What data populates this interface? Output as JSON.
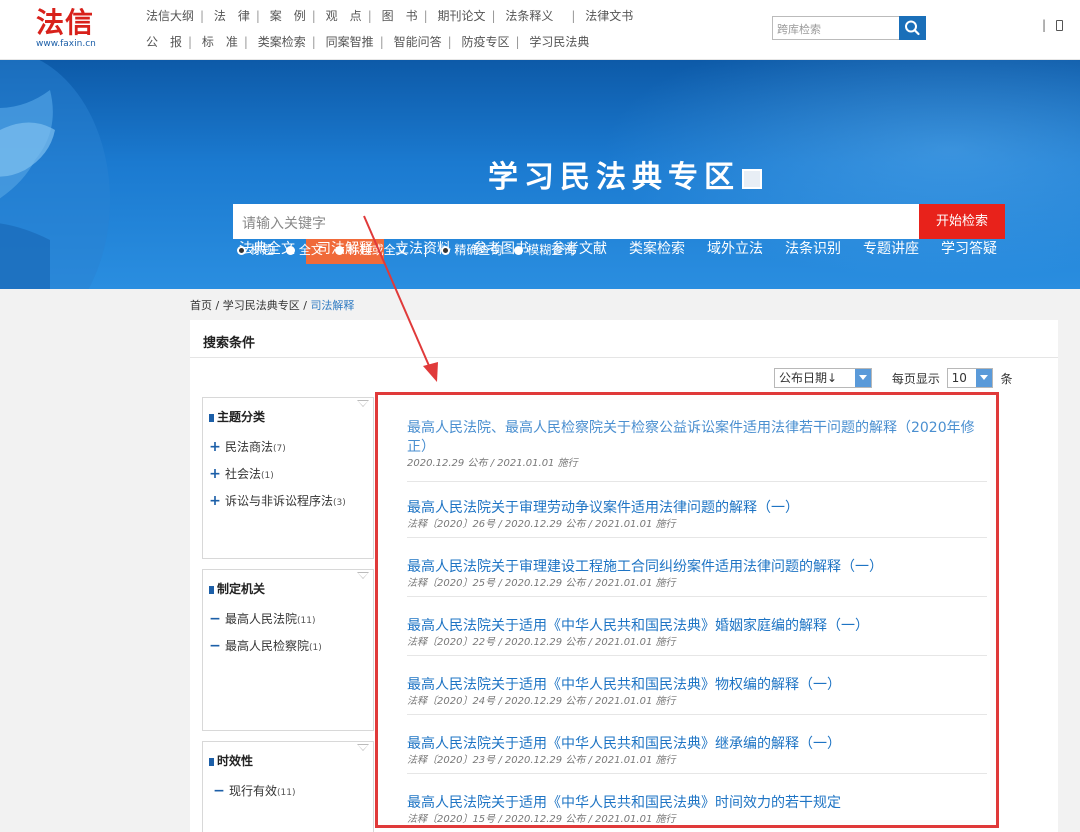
{
  "logo": {
    "text": "法信",
    "url": "www.faxin.cn"
  },
  "top_nav": {
    "row1": [
      "法信大纲",
      "法　律",
      "案　例",
      "观　点",
      "图　书",
      "期刊论文",
      "法条释义",
      "法律文书"
    ],
    "row2": [
      "公　报",
      "标　准",
      "类案检索",
      "同案智推",
      "智能问答",
      "防疫专区",
      "学习民法典"
    ],
    "search_placeholder": "跨库检索",
    "right_text": "|"
  },
  "banner": {
    "title": "学习民法典专区",
    "tabs": [
      "法典全文",
      "司法解释",
      "立法资料",
      "参考图书",
      "参考文献",
      "类案检索",
      "域外立法",
      "法条识别",
      "专题讲座",
      "学习答疑"
    ],
    "active_tab": "司法解释",
    "search_placeholder": "请输入关键字",
    "search_button": "开始检索",
    "scope_options": [
      "标题",
      "全文",
      "标题或全文"
    ],
    "match_options": [
      "精确查询",
      "模糊查询"
    ]
  },
  "breadcrumb": {
    "home": "首页",
    "sep": "/",
    "section": "学习民法典专区",
    "current": "司法解释"
  },
  "panel": {
    "header": "搜索条件",
    "sort_label": "公布日期↓",
    "per_page_label": "每页显示",
    "per_page_value": "10",
    "per_page_unit": "条"
  },
  "filters": {
    "topic": {
      "title": "主题分类",
      "items": [
        {
          "label": "民法商法",
          "count": "(7)"
        },
        {
          "label": "社会法",
          "count": "(1)"
        },
        {
          "label": "诉讼与非诉讼程序法",
          "count": "(3)"
        }
      ]
    },
    "authority": {
      "title": "制定机关",
      "items": [
        {
          "label": "最高人民法院",
          "count": "(11)"
        },
        {
          "label": "最高人民检察院",
          "count": "(1)"
        }
      ]
    },
    "validity": {
      "title": "时效性",
      "items": [
        {
          "label": "现行有效",
          "count": "(11)"
        }
      ]
    }
  },
  "results": [
    {
      "title": "最高人民法院、最高人民检察院关于检察公益诉讼案件适用法律若干问题的解释（2020年修正）",
      "meta": "2020.12.29 公布 / 2021.01.01 施行"
    },
    {
      "title": "最高人民法院关于审理劳动争议案件适用法律问题的解释（一）",
      "meta": "法释〔2020〕26号 / 2020.12.29 公布 / 2021.01.01 施行"
    },
    {
      "title": "最高人民法院关于审理建设工程施工合同纠纷案件适用法律问题的解释（一）",
      "meta": "法释〔2020〕25号 / 2020.12.29 公布 / 2021.01.01 施行"
    },
    {
      "title": "最高人民法院关于适用《中华人民共和国民法典》婚姻家庭编的解释（一）",
      "meta": "法释〔2020〕22号 / 2020.12.29 公布 / 2021.01.01 施行"
    },
    {
      "title": "最高人民法院关于适用《中华人民共和国民法典》物权编的解释（一）",
      "meta": "法释〔2020〕24号 / 2020.12.29 公布 / 2021.01.01 施行"
    },
    {
      "title": "最高人民法院关于适用《中华人民共和国民法典》继承编的解释（一）",
      "meta": "法释〔2020〕23号 / 2020.12.29 公布 / 2021.01.01 施行"
    },
    {
      "title": "最高人民法院关于适用《中华人民共和国民法典》时间效力的若干规定",
      "meta": "法释〔2020〕15号 / 2020.12.29 公布 / 2021.01.01 施行"
    }
  ],
  "colors": {
    "brand_red": "#d8211b",
    "link_blue": "#1e74c4",
    "accent_orange": "#f06a3a",
    "annotation_red": "#e03a3a"
  }
}
